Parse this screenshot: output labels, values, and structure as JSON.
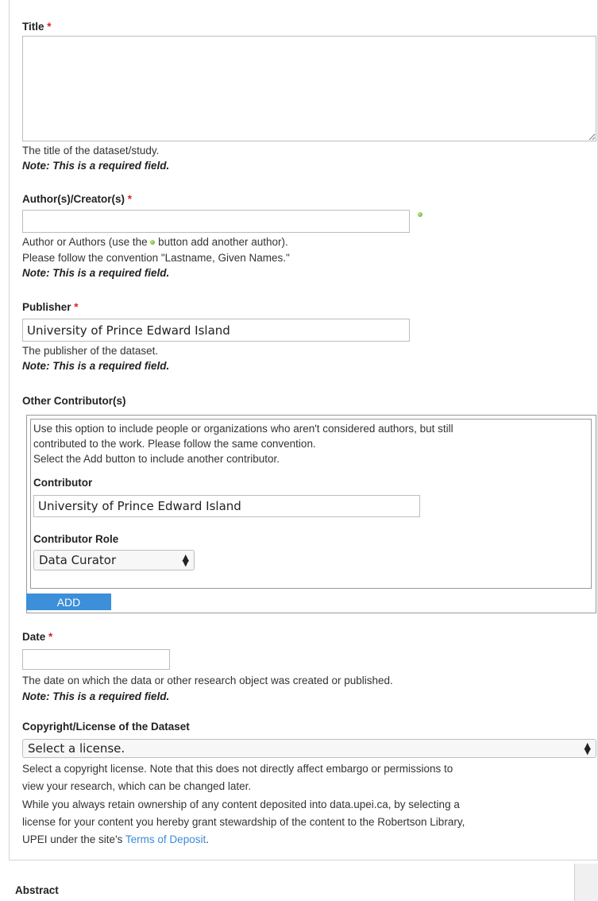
{
  "title_field": {
    "label": "Title",
    "required_mark": "*",
    "value": "",
    "description": "The title of the dataset/study.",
    "note": "Note: This is a required field."
  },
  "author_field": {
    "label": "Author(s)/Creator(s)",
    "required_mark": "*",
    "value": "",
    "description_before_icon": "Author or Authors (use the",
    "description_after_icon": "button add another author).",
    "description_line2": "Please follow the convention \"Lastname, Given Names.\"",
    "note": "Note: This is a required field."
  },
  "publisher_field": {
    "label": "Publisher",
    "required_mark": "*",
    "value": "University of Prince Edward Island",
    "description": "The publisher of the dataset.",
    "note": "Note: This is a required field."
  },
  "contributors": {
    "legend": "Other Contributor(s)",
    "help_line1": "Use this option to include people or organizations who aren't considered authors, but still",
    "help_line2": "contributed to the work. Please follow the same convention.",
    "help_line3": "Select the Add button to include another contributor.",
    "contributor_label": "Contributor",
    "contributor_value": "University of Prince Edward Island",
    "role_label": "Contributor Role",
    "role_value": "Data Curator",
    "add_label": "ADD"
  },
  "date_field": {
    "label": "Date",
    "required_mark": "*",
    "value": "",
    "description": "The date on which the data or other research object was created or published.",
    "note": "Note: This is a required field."
  },
  "license_field": {
    "label": "Copyright/License of the Dataset",
    "value": "Select a license.",
    "desc_line1": "Select a copyright license. Note that this does not directly affect embargo or permissions to",
    "desc_line2": "view your research, which can be changed later.",
    "desc_line3": "While you always retain ownership of any content deposited into data.upei.ca, by selecting a",
    "desc_line4": "license for your content you hereby grant stewardship of the content to the Robertson Library,",
    "desc_line5_before_link": "UPEI under the site's",
    "link_text": "Terms of Deposit",
    "desc_line5_after_link": "."
  },
  "abstract_field": {
    "label": "Abstract"
  },
  "icons": {
    "add_author": "green-plus-icon",
    "select_arrow": "up-down-arrows-icon"
  },
  "colors": {
    "required": "#e02020",
    "add_button": "#3c8fd8",
    "link": "#3b8bd6"
  }
}
